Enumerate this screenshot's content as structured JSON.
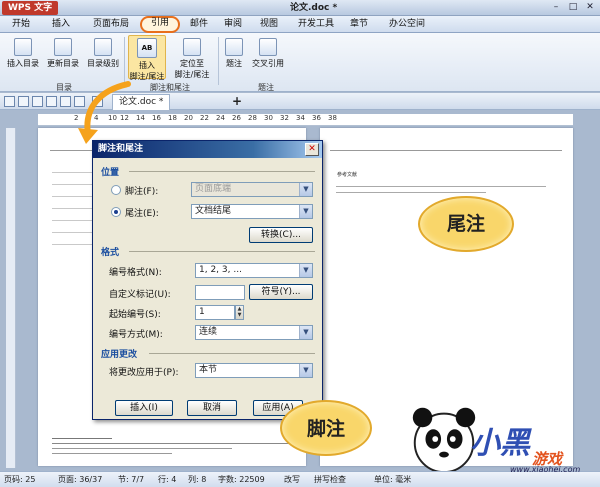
{
  "app": {
    "logo": "WPS 文字",
    "title": "论文.doc *",
    "window_buttons": [
      "–",
      "□",
      "✕"
    ]
  },
  "menu": {
    "tabs": [
      "开始",
      "插入",
      "页面布局",
      "引用",
      "邮件",
      "审阅",
      "视图",
      "开发工具",
      "章节",
      "办公空间"
    ],
    "active": "引用"
  },
  "ribbon": {
    "insert_toc": "插入目录",
    "update_toc": "更新目录",
    "toc_level": "目录级别",
    "toc_group": "目录",
    "insert_footnote_line1": "插入",
    "insert_footnote_line2": "脚注/尾注",
    "goto_footnote_line1": "定位至",
    "goto_footnote_line2": "脚注/尾注",
    "footnote_group": "脚注和尾注",
    "caption": "题注",
    "cross_ref": "交叉引用",
    "caption_group": "题注"
  },
  "quickbar": {
    "doc_tab": "论文.doc *",
    "new_tab": "+"
  },
  "ruler": {
    "ticks": [
      "2",
      "4",
      "6",
      "8",
      "10",
      "12",
      "14",
      "16",
      "18",
      "20",
      "22",
      "24",
      "26",
      "28",
      "30",
      "32",
      "34",
      "36",
      "38"
    ]
  },
  "page2": {
    "endnote_title": "参考文献"
  },
  "dialog": {
    "title": "脚注和尾注",
    "close": "✕",
    "section_position": "位置",
    "footnote_label": "脚注(F):",
    "footnote_value": "页面底端",
    "endnote_label": "尾注(E):",
    "endnote_value": "文档结尾",
    "convert_button": "转换(C)...",
    "section_format": "格式",
    "number_format_label": "编号格式(N):",
    "number_format_value": "1, 2, 3, ...",
    "custom_mark_label": "自定义标记(U):",
    "custom_mark_value": "",
    "symbol_button": "符号(Y)...",
    "start_number_label": "起始编号(S):",
    "start_number_value": "1",
    "numbering_label": "编号方式(M):",
    "numbering_value": "连续",
    "section_apply": "应用更改",
    "apply_to_label": "将更改应用于(P):",
    "apply_to_value": "本节",
    "insert_button": "插入(I)",
    "cancel_button": "取消",
    "apply_button": "应用(A)",
    "selected_position": "endnote"
  },
  "annotations": {
    "endnote_bubble": "尾注",
    "footnote_bubble": "脚注"
  },
  "watermark": {
    "brand": "小黑",
    "brand_sub": "游戏",
    "url": "www.xiaohei.com"
  },
  "status": {
    "page": "页码: 25",
    "pages": "页面: 36/37",
    "section": "节: 7/7",
    "row": "行: 4",
    "col": "列: 8",
    "words": "字数: 22509",
    "overwrite": "改写",
    "spellcheck": "拼写检查",
    "unit": "单位: 毫米"
  },
  "colors": {
    "accent_orange": "#e86f1c",
    "dialog_title": "#0a246a",
    "bubble": "#f9d66a"
  }
}
